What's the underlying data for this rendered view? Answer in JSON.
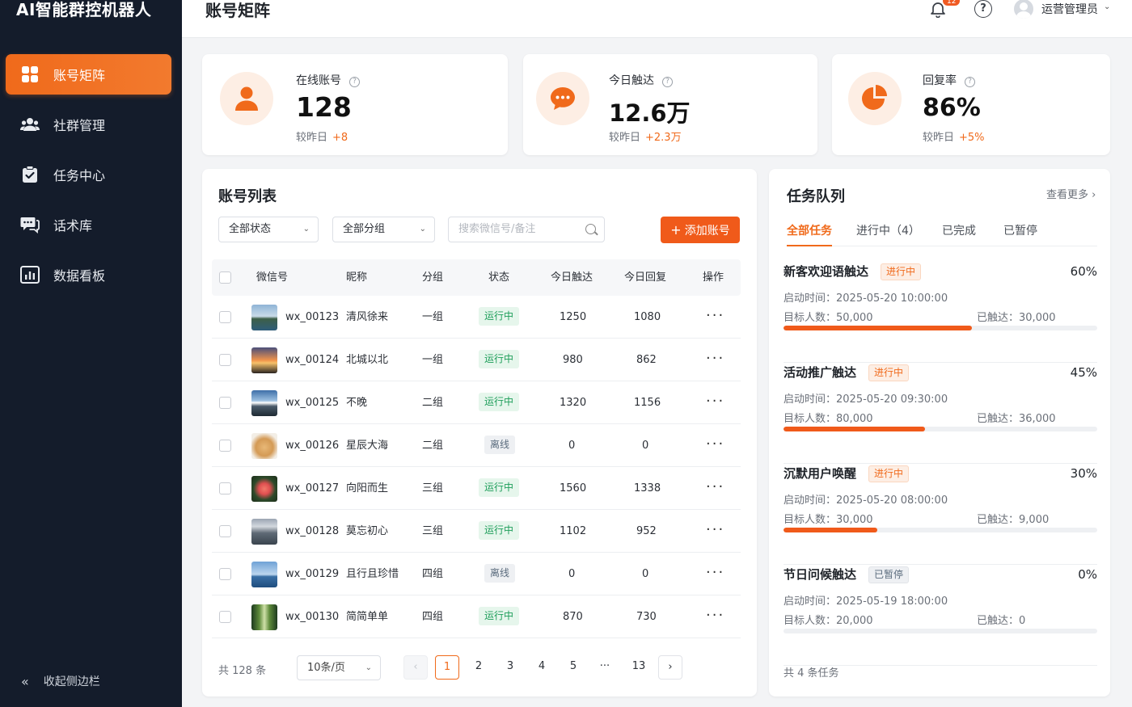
{
  "app": {
    "title": "AI智能群控机器人"
  },
  "sidebar": {
    "items": [
      {
        "label": "账号矩阵",
        "icon": "grid-icon",
        "active": true
      },
      {
        "label": "社群管理",
        "icon": "users-icon",
        "active": false
      },
      {
        "label": "任务中心",
        "icon": "clipboard-check-icon",
        "active": false
      },
      {
        "label": "话术库",
        "icon": "chat-bubbles-icon",
        "active": false
      },
      {
        "label": "数据看板",
        "icon": "bar-chart-icon",
        "active": false
      }
    ],
    "collapse_label": "收起侧边栏"
  },
  "header": {
    "title": "账号矩阵",
    "notification_count": "12",
    "user_name": "运营管理员"
  },
  "stats": [
    {
      "label": "在线账号",
      "value": "128",
      "compare_label": "较昨日",
      "delta": "+8",
      "icon": "user-icon"
    },
    {
      "label": "今日触达",
      "value": "12.6万",
      "compare_label": "较昨日",
      "delta": "+2.3万",
      "icon": "chat-icon"
    },
    {
      "label": "回复率",
      "value": "86%",
      "compare_label": "较昨日",
      "delta": "+5%",
      "icon": "pie-icon"
    }
  ],
  "account_list": {
    "title": "账号列表",
    "status_filter": "全部状态",
    "group_filter": "全部分组",
    "search_placeholder": "搜索微信号/备注",
    "add_button": "添加账号",
    "columns": [
      "微信号",
      "昵称",
      "分组",
      "状态",
      "今日触达",
      "今日回复",
      "操作"
    ],
    "rows": [
      {
        "wechat": "wx_00123",
        "nickname": "清风徐来",
        "group": "一组",
        "status": "运行中",
        "reach": "1250",
        "reply": "1080",
        "thumb": "lake"
      },
      {
        "wechat": "wx_00124",
        "nickname": "北城以北",
        "group": "一组",
        "status": "运行中",
        "reach": "980",
        "reply": "862",
        "thumb": "sunset"
      },
      {
        "wechat": "wx_00125",
        "nickname": "不晚",
        "group": "二组",
        "status": "运行中",
        "reach": "1320",
        "reply": "1156",
        "thumb": "mountain"
      },
      {
        "wechat": "wx_00126",
        "nickname": "星辰大海",
        "group": "二组",
        "status": "离线",
        "reach": "0",
        "reply": "0",
        "thumb": "dog"
      },
      {
        "wechat": "wx_00127",
        "nickname": "向阳而生",
        "group": "三组",
        "status": "运行中",
        "reach": "1560",
        "reply": "1338",
        "thumb": "flower"
      },
      {
        "wechat": "wx_00128",
        "nickname": "莫忘初心",
        "group": "三组",
        "status": "运行中",
        "reach": "1102",
        "reply": "952",
        "thumb": "city"
      },
      {
        "wechat": "wx_00129",
        "nickname": "且行且珍惜",
        "group": "四组",
        "status": "离线",
        "reach": "0",
        "reply": "0",
        "thumb": "sea"
      },
      {
        "wechat": "wx_00130",
        "nickname": "简简单单",
        "group": "四组",
        "status": "运行中",
        "reach": "870",
        "reply": "730",
        "thumb": "forest"
      }
    ],
    "pagination": {
      "total": "共 128 条",
      "page_size": "10条/页",
      "pages": [
        "1",
        "2",
        "3",
        "4",
        "5",
        "···",
        "13"
      ],
      "current": "1"
    }
  },
  "task_queue": {
    "title": "任务队列",
    "more": "查看更多",
    "tabs": [
      "全部任务",
      "进行中（4）",
      "已完成",
      "已暂停"
    ],
    "start_label": "启动时间：",
    "target_label": "目标人数：",
    "reached_label": "已触达：",
    "tasks": [
      {
        "name": "新客欢迎语触达",
        "tag": "进行中",
        "percent": "60%",
        "progress": 0.6,
        "start": "2025-05-20 10:00:00",
        "target": "50,000",
        "reached": "30,000"
      },
      {
        "name": "活动推广触达",
        "tag": "进行中",
        "percent": "45%",
        "progress": 0.45,
        "start": "2025-05-20 09:30:00",
        "target": "80,000",
        "reached": "36,000"
      },
      {
        "name": "沉默用户唤醒",
        "tag": "进行中",
        "percent": "30%",
        "progress": 0.3,
        "start": "2025-05-20 08:00:00",
        "target": "30,000",
        "reached": "9,000"
      },
      {
        "name": "节日问候触达",
        "tag": "已暂停",
        "percent": "0%",
        "progress": 0,
        "start": "2025-05-19 18:00:00",
        "target": "20,000",
        "reached": "0"
      }
    ],
    "total": "共 4 条任务"
  },
  "colors": {
    "accent": "#f06a1b",
    "sidebar_bg": "#141c2b",
    "success": "#1e9e5a"
  }
}
